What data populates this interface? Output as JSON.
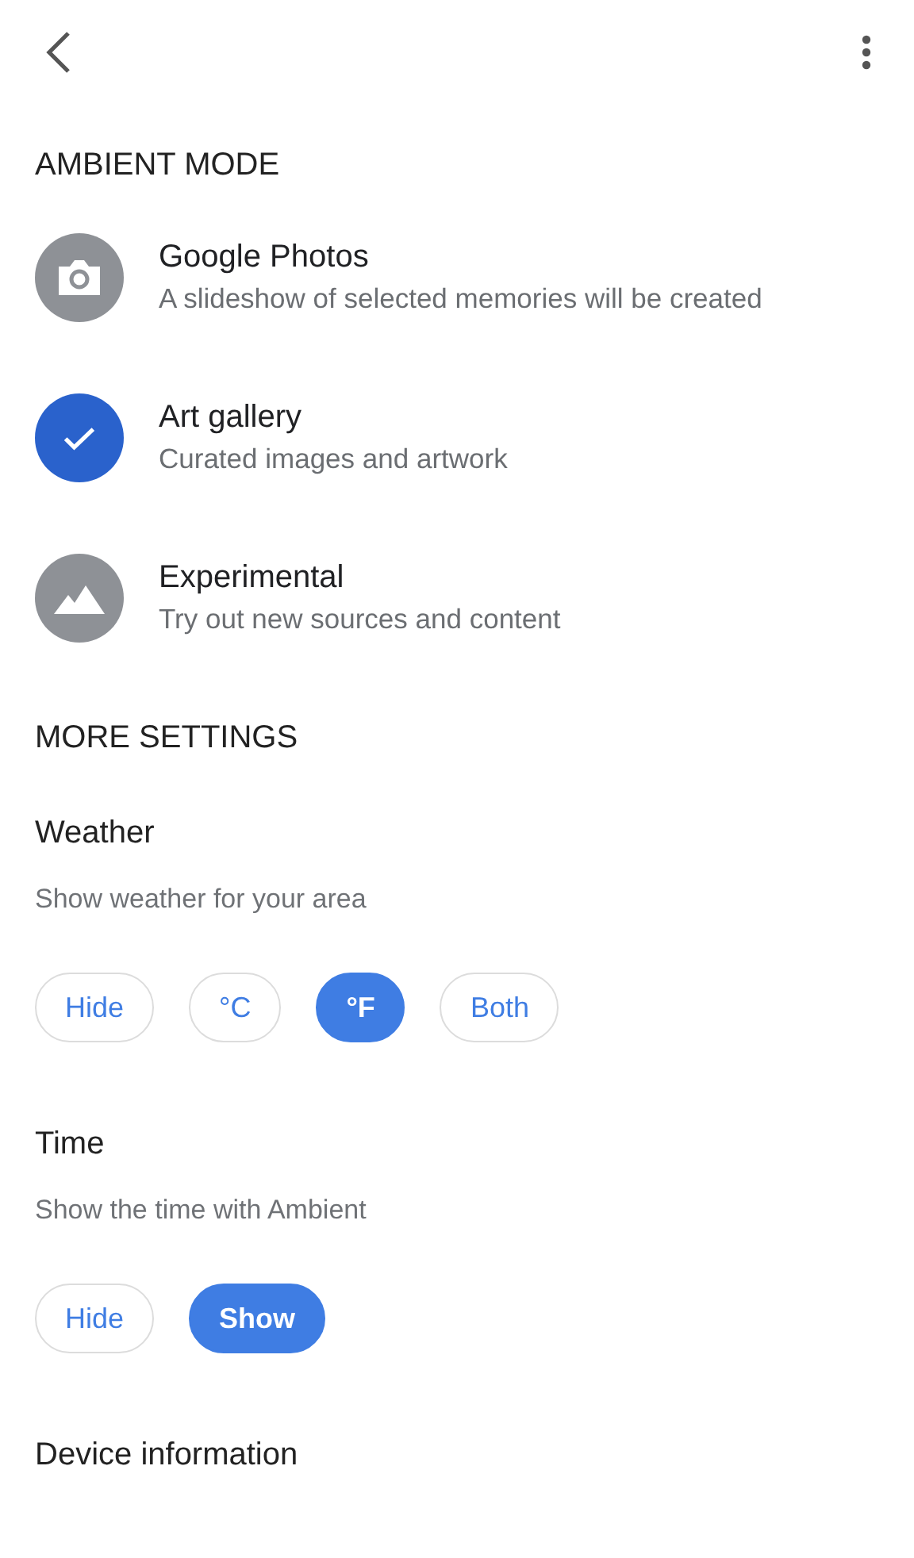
{
  "sections": [
    {
      "title": "AMBIENT MODE",
      "sources": [
        {
          "kind": "camera",
          "title": "Google Photos",
          "subtitle": "A slideshow of selected memories will be created",
          "selected": false
        },
        {
          "title": "Art gallery",
          "subtitle": "Curated images and artwork",
          "selected": true
        },
        {
          "kind": "mountain",
          "title": "Experimental",
          "subtitle": "Try out new sources and content",
          "selected": false
        }
      ]
    },
    {
      "title": "MORE SETTINGS",
      "settings": [
        {
          "label": "Weather",
          "description": "Show weather for your area",
          "options": [
            {
              "label": "Hide",
              "selected": false
            },
            {
              "label": "°C",
              "selected": false
            },
            {
              "label": "°F",
              "selected": true
            },
            {
              "label": "Both",
              "selected": false
            }
          ]
        },
        {
          "label": "Time",
          "description": "Show the time with Ambient",
          "options": [
            {
              "label": "Hide",
              "selected": false
            },
            {
              "label": "Show",
              "selected": true
            }
          ]
        },
        {
          "label": "Device information"
        }
      ]
    }
  ]
}
